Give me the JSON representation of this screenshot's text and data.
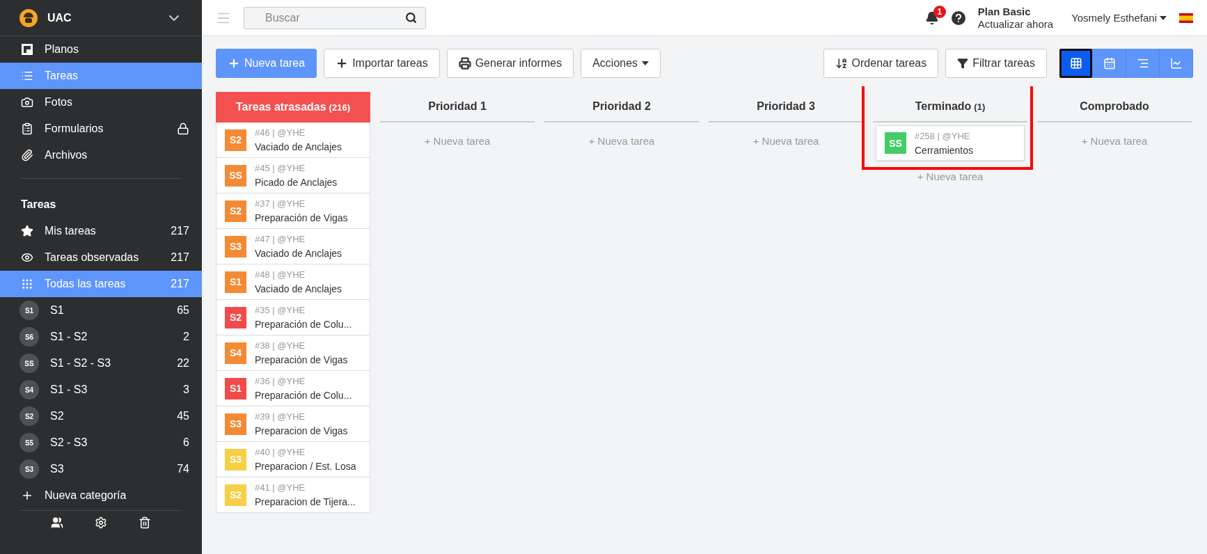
{
  "sidebar": {
    "project": "UAC",
    "nav": [
      {
        "label": "Planos",
        "selected": false,
        "locked": false
      },
      {
        "label": "Tareas",
        "selected": true,
        "locked": false
      },
      {
        "label": "Fotos",
        "selected": false,
        "locked": false
      },
      {
        "label": "Formularios",
        "selected": false,
        "locked": true
      },
      {
        "label": "Archivos",
        "selected": false,
        "locked": false
      }
    ],
    "section_title": "Tareas",
    "filters": [
      {
        "label": "Mis tareas",
        "count": "217",
        "selected": false
      },
      {
        "label": "Tareas observadas",
        "count": "217",
        "selected": false
      },
      {
        "label": "Todas las tareas",
        "count": "217",
        "selected": true
      }
    ],
    "categories": [
      {
        "badge": "S1",
        "label": "S1",
        "count": "65"
      },
      {
        "badge": "S6",
        "label": "S1 - S2",
        "count": "2"
      },
      {
        "badge": "SS",
        "label": "S1 - S2 - S3",
        "count": "22"
      },
      {
        "badge": "S4",
        "label": "S1 - S3",
        "count": "3"
      },
      {
        "badge": "S2",
        "label": "S2",
        "count": "45"
      },
      {
        "badge": "S5",
        "label": "S2 - S3",
        "count": "6"
      },
      {
        "badge": "S3",
        "label": "S3",
        "count": "74"
      }
    ],
    "new_category": "Nueva categoría"
  },
  "topbar": {
    "search": {
      "placeholder": "Buscar"
    },
    "notifications": "1",
    "plan": "Plan Basic",
    "upgrade": "Actualizar ahora",
    "user": "Yosmely Esthefani"
  },
  "toolbar": {
    "left": [
      "Nueva tarea",
      "Importar tareas",
      "Generar informes",
      "Acciones"
    ],
    "right": [
      "Ordenar tareas",
      "Filtrar tareas"
    ],
    "views": [
      {
        "selected": true
      },
      {
        "selected": false
      },
      {
        "selected": false
      },
      {
        "selected": false
      }
    ]
  },
  "board": {
    "columns": [
      {
        "title": "Tareas atrasadas",
        "count": "(216)",
        "kind": "overdue",
        "highlighted": false,
        "cards": [
          {
            "badge": "S2",
            "color": "#f58a35",
            "meta": "#46 | @YHE",
            "title": "Vaciado de Anclajes"
          },
          {
            "badge": "SS",
            "color": "#f58a35",
            "meta": "#45 | @YHE",
            "title": "Picado de Anclajes"
          },
          {
            "badge": "S2",
            "color": "#f58a35",
            "meta": "#37 | @YHE",
            "title": "Preparación de Vigas"
          },
          {
            "badge": "S3",
            "color": "#f58a35",
            "meta": "#47 | @YHE",
            "title": "Vaciado de Anclajes"
          },
          {
            "badge": "S1",
            "color": "#f58a35",
            "meta": "#48 | @YHE",
            "title": "Vaciado de Anclajes"
          },
          {
            "badge": "S2",
            "color": "#f24a4a",
            "meta": "#35 | @YHE",
            "title": "Preparación de Colu..."
          },
          {
            "badge": "S4",
            "color": "#f58a35",
            "meta": "#38 | @YHE",
            "title": "Preparación de Vigas"
          },
          {
            "badge": "S1",
            "color": "#f24a4a",
            "meta": "#36 | @YHE",
            "title": "Preparación de Colu..."
          },
          {
            "badge": "S3",
            "color": "#f58a35",
            "meta": "#39 | @YHE",
            "title": "Preparacion de Vigas"
          },
          {
            "badge": "S3",
            "color": "#f7cf45",
            "meta": "#40 | @YHE",
            "title": "Preparacion / Est. Losa"
          },
          {
            "badge": "S2",
            "color": "#f7cf45",
            "meta": "#41 | @YHE",
            "title": "Preparacion de Tijera..."
          }
        ]
      },
      {
        "title": "Prioridad 1",
        "kind": "normal",
        "highlighted": false,
        "new_task": "+ Nueva tarea"
      },
      {
        "title": "Prioridad 2",
        "kind": "normal",
        "highlighted": false,
        "new_task": "+ Nueva tarea"
      },
      {
        "title": "Prioridad 3",
        "kind": "normal",
        "highlighted": false,
        "new_task": "+ Nueva tarea"
      },
      {
        "title": "Terminado",
        "count": "(1)",
        "kind": "normal",
        "highlighted": true,
        "new_task": "+ Nueva tarea",
        "cards": [
          {
            "badge": "SS",
            "color": "#44cc66",
            "meta": "#258 | @YHE",
            "title": "Cerramientos"
          }
        ]
      },
      {
        "title": "Comprobado",
        "kind": "normal",
        "highlighted": false,
        "new_task": "+ Nueva tarea"
      }
    ]
  }
}
